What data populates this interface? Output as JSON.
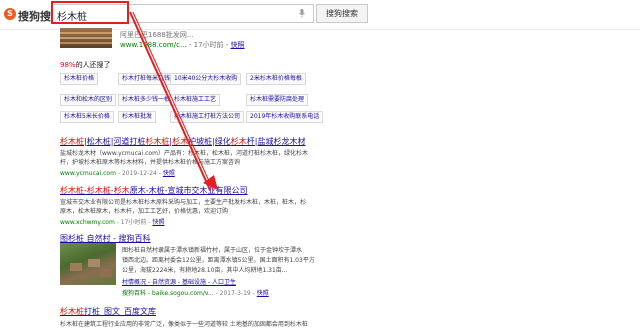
{
  "header": {
    "logo_badge": "S",
    "logo_text": "搜狗搜索",
    "search_value": "杉木桩",
    "search_button": "搜狗搜索"
  },
  "result_top": {
    "line1": "阿里巴巴1688批发网...",
    "url": "www.1688.com/c...",
    "time": "17小时前",
    "snapshot": "快照"
  },
  "related": {
    "percent": "98%",
    "label": "的人还搜了",
    "tags": [
      [
        "杉木桩价格",
        "杉木打桩每米几钱",
        "10米40公分大杉木收购",
        "2米杉木桩价格每根"
      ],
      [
        "杉木和松木的区别",
        "杉木桩多少钱一根",
        "杉木桩施工工艺",
        "杉木桩需要防腐处理"
      ],
      [
        "杉木桩5米长价格",
        "杉木桩批发",
        "杉木桩施工打桩方法公司",
        "2019年杉木收购联系电话"
      ]
    ]
  },
  "result1": {
    "title": "杉木桩|松木桩|河道打桩杉木桩|杉木护坡桩|绿化杉木杆|盐城杉龙木材",
    "desc1": "盐城杉龙木材（www.ycmucai.com）产品有：杉木桩，松木桩，河道打桩杉木桩，绿化杉木",
    "desc2": "杆，护坡杉木桩原木等杉木材料，并提供杉木桩价格与施工方案咨询",
    "url": "www.ycmucai.com",
    "date": "2019-12-24",
    "snapshot": "快照"
  },
  "result2": {
    "title": "杉木桩-杉木桩-杉木原木-木桩-宣城市交木业有限公司",
    "desc1": "宣城市交木业有限公司是杉木桩杉木原料采购与加工，主要生产批发杉木桩，木桩，桩木，杉",
    "desc2": "原木，松木桩原木，杉木杆，加工工艺好，价格优惠，欢迎订购",
    "url": "www.xchwmy.com",
    "time": "17小时前",
    "snapshot": "快照"
  },
  "result3": {
    "title": "图杉桩 自然村 - 搜狗百科",
    "desc1": "图杉桩自然村隶属于潭水镇新福竹村，属于山区，位于金钟坎于潭水",
    "desc2": "镇西北边。距离村委会12公里，距离潭水镇5公里。国土面积有1.03平方",
    "desc3": "公里，海拔2224米，有耕地28.10亩，其中人均耕地1.31亩...",
    "links": "村情概况 - 自然资源 - 基础设施 - 人口卫生",
    "source": "搜狗百科",
    "url": "baike.sogou.com/v...",
    "date": "2017-3-19",
    "snapshot": "快照"
  },
  "result4": {
    "title": "杉木桩打桩_图文_百度文库",
    "desc1": "杉木桩在建筑工程行业应用的非常广泛，像类似于一些河道等较 土地基的加固都会用到杉木桩"
  }
}
